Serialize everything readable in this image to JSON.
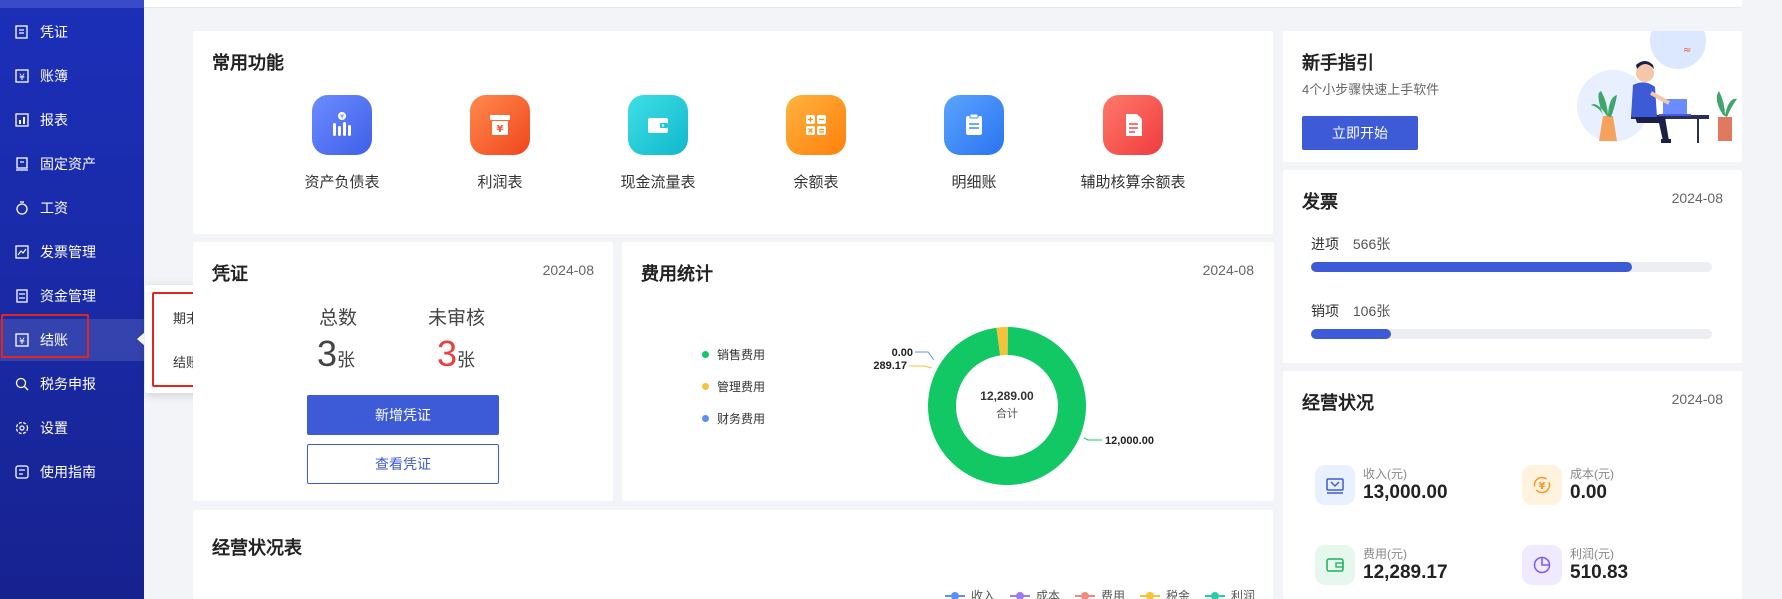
{
  "sidebar": {
    "items": [
      {
        "label": "凭证",
        "icon": "voucher-icon"
      },
      {
        "label": "账簿",
        "icon": "ledger-icon"
      },
      {
        "label": "报表",
        "icon": "report-icon"
      },
      {
        "label": "固定资产",
        "icon": "fixed-asset-icon"
      },
      {
        "label": "工资",
        "icon": "salary-icon"
      },
      {
        "label": "发票管理",
        "icon": "invoice-icon"
      },
      {
        "label": "资金管理",
        "icon": "fund-icon"
      },
      {
        "label": "结账",
        "icon": "closing-icon"
      },
      {
        "label": "税务申报",
        "icon": "tax-icon"
      },
      {
        "label": "设置",
        "icon": "settings-icon"
      },
      {
        "label": "使用指南",
        "icon": "guide-icon"
      }
    ],
    "active_index": 7
  },
  "popover": {
    "items": [
      "期末结转",
      "结账"
    ]
  },
  "common_functions": {
    "title": "常用功能",
    "items": [
      {
        "label": "资产负债表",
        "icon": "balance-sheet-icon",
        "color": "#4a6cf0"
      },
      {
        "label": "利润表",
        "icon": "income-statement-icon",
        "color": "#f5582c"
      },
      {
        "label": "现金流量表",
        "icon": "cash-flow-icon",
        "color": "#1ec8d8"
      },
      {
        "label": "余额表",
        "icon": "calculator-icon",
        "color": "#ff9316"
      },
      {
        "label": "明细账",
        "icon": "clipboard-icon",
        "color": "#3f8bff"
      },
      {
        "label": "辅助核算余额表",
        "icon": "document-icon",
        "color": "#f5484a"
      }
    ]
  },
  "voucher": {
    "title": "凭证",
    "date": "2024-08",
    "total_label": "总数",
    "total_value": "3",
    "unaudited_label": "未审核",
    "unaudited_value": "3",
    "unit": "张",
    "add_button": "新增凭证",
    "view_button": "查看凭证"
  },
  "expense": {
    "title": "费用统计",
    "date": "2024-08",
    "center_value": "12,289.00",
    "center_label": "合计",
    "legend": [
      {
        "name": "销售费用",
        "color": "#12c864"
      },
      {
        "name": "管理费用",
        "color": "#f5c33b"
      },
      {
        "name": "财务费用",
        "color": "#5b8ff9"
      }
    ],
    "labels": [
      "0.00",
      "289.17",
      "12,000.00"
    ]
  },
  "chart_data": {
    "type": "pie",
    "title": "费用统计",
    "categories": [
      "销售费用",
      "管理费用",
      "财务费用"
    ],
    "values": [
      12000.0,
      289.17,
      0.0
    ],
    "total": 12289.0,
    "legend_position": "left"
  },
  "guide": {
    "title": "新手指引",
    "subtitle": "4个小步骤快速上手软件",
    "button": "立即开始"
  },
  "invoice": {
    "title": "发票",
    "date": "2024-08",
    "in_label": "进项",
    "in_value": "566张",
    "in_fraction": 0.8,
    "out_label": "销项",
    "out_value": "106张",
    "out_fraction": 0.2
  },
  "business": {
    "title": "经营状况",
    "date": "2024-08",
    "kpis": [
      {
        "label": "收入(元)",
        "value": "13,000.00",
        "icon": "income-icon",
        "bg": "#e9f0ff",
        "fg": "#3d5bd6"
      },
      {
        "label": "成本(元)",
        "value": "0.00",
        "icon": "cost-icon",
        "bg": "#fff3e0",
        "fg": "#f59a23"
      },
      {
        "label": "费用(元)",
        "value": "12,289.17",
        "icon": "expense-icon",
        "bg": "#e6f8ee",
        "fg": "#17b35c"
      },
      {
        "label": "利润(元)",
        "value": "510.83",
        "icon": "profit-icon",
        "bg": "#efeaff",
        "fg": "#7b5cf0"
      }
    ]
  },
  "business_table": {
    "title": "经营状况表",
    "legend": [
      {
        "name": "收入",
        "color": "#5b8ff9"
      },
      {
        "name": "成本",
        "color": "#9a7bf0"
      },
      {
        "name": "费用",
        "color": "#f08a7e"
      },
      {
        "name": "税金",
        "color": "#f5c33b"
      },
      {
        "name": "利润",
        "color": "#2fc9a8"
      }
    ]
  }
}
